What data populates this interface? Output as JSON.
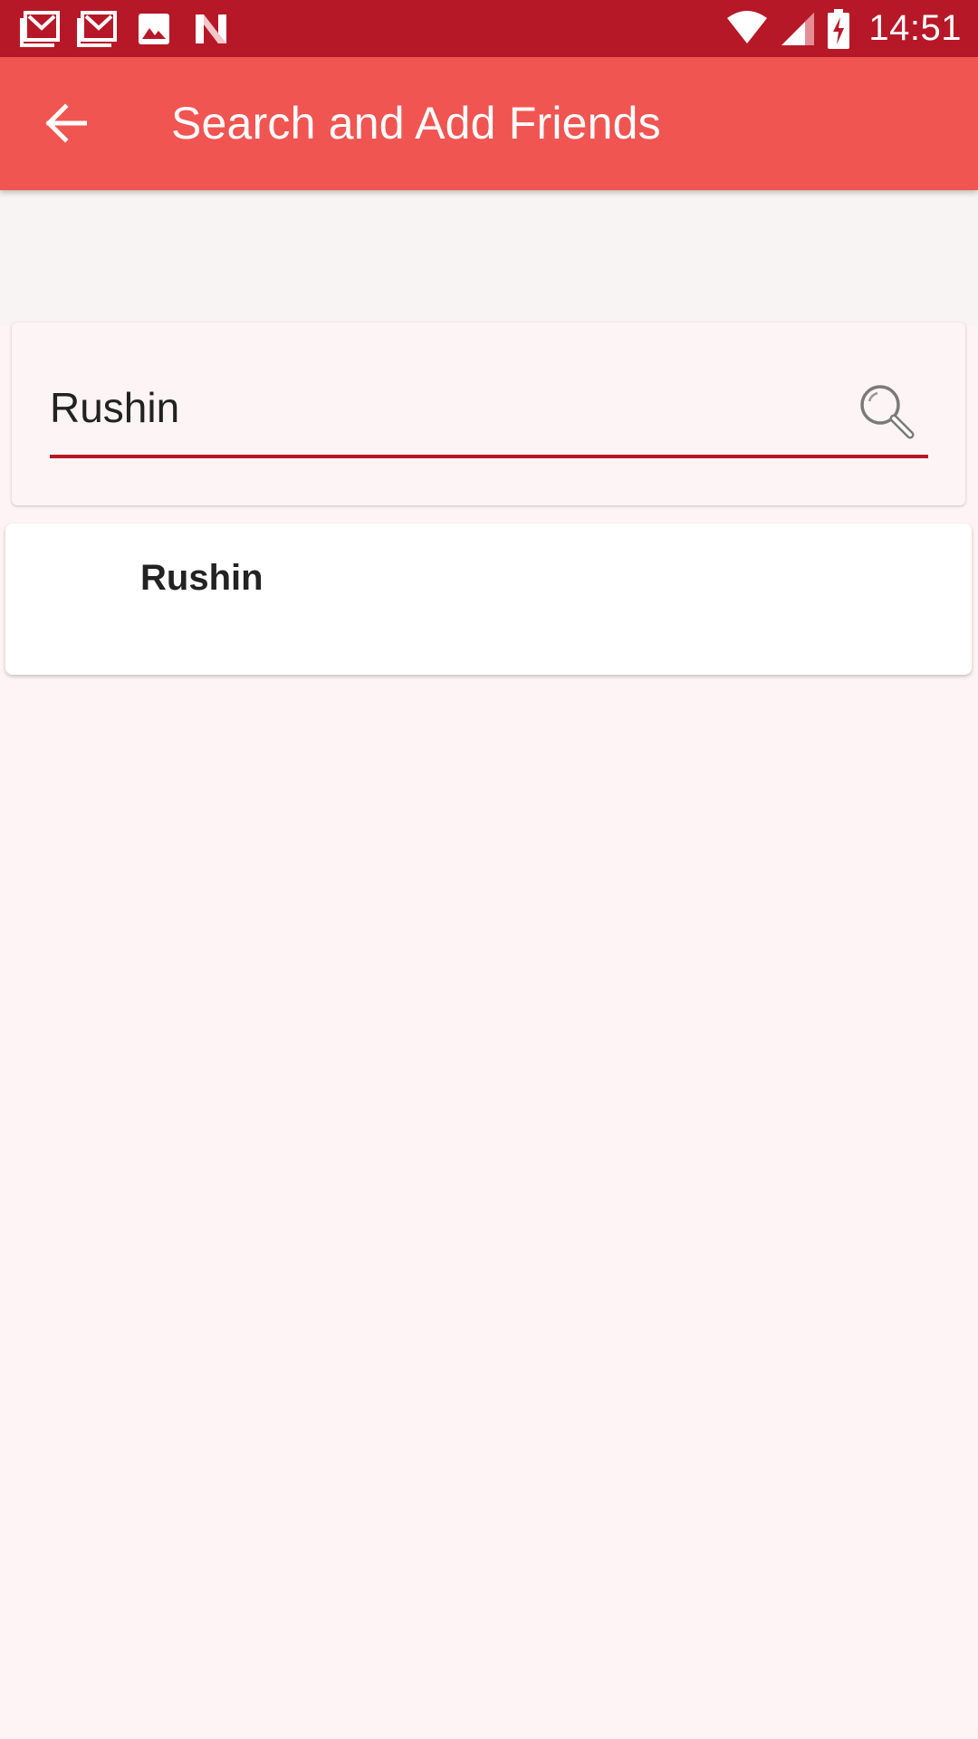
{
  "status_bar": {
    "time": "14:51",
    "notification_icons": [
      "gmail-icon",
      "gmail-icon",
      "image-icon",
      "n-app-icon"
    ],
    "system_icons": [
      "wifi-icon",
      "signal-icon",
      "battery-charging-icon"
    ],
    "background_color": "#B71828"
  },
  "app_bar": {
    "title": "Search and Add Friends",
    "back_icon": "arrow-back-icon",
    "background_color": "#F05552"
  },
  "search": {
    "value": "Rushin",
    "search_icon": "magnifier-icon",
    "underline_color": "#B71828"
  },
  "results": [
    {
      "name": "Rushin"
    }
  ]
}
